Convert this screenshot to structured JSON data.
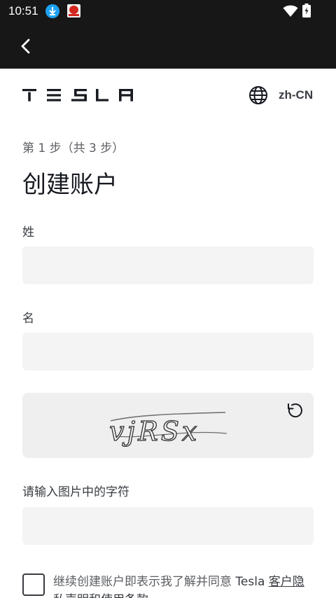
{
  "status_bar": {
    "time": "10:51",
    "icons": [
      "download-icon",
      "app-notification-icon",
      "wifi-icon",
      "battery-charging-icon"
    ]
  },
  "header": {
    "back_icon": "back-arrow-icon",
    "brand": "TESLA",
    "language_icon": "globe-icon",
    "language": "zh-CN"
  },
  "form": {
    "step": "第 1 步（共 3 步）",
    "title": "创建账户",
    "last_name": {
      "label": "姓",
      "value": ""
    },
    "first_name": {
      "label": "名",
      "value": ""
    },
    "captcha": {
      "text": "vjRSx",
      "refresh_icon": "refresh-icon"
    },
    "captcha_input": {
      "label": "请输入图片中的字符",
      "value": ""
    },
    "terms": {
      "checked": false,
      "prefix": "继续创建账户即表示我了解并同意 ",
      "brand": "Tesla",
      "link": "客户隐私声明和使用条款"
    }
  },
  "colors": {
    "status_bar_bg": "#171717",
    "input_bg": "#f4f4f4",
    "text_primary": "#171a20",
    "text_secondary": "#5c5e62"
  }
}
